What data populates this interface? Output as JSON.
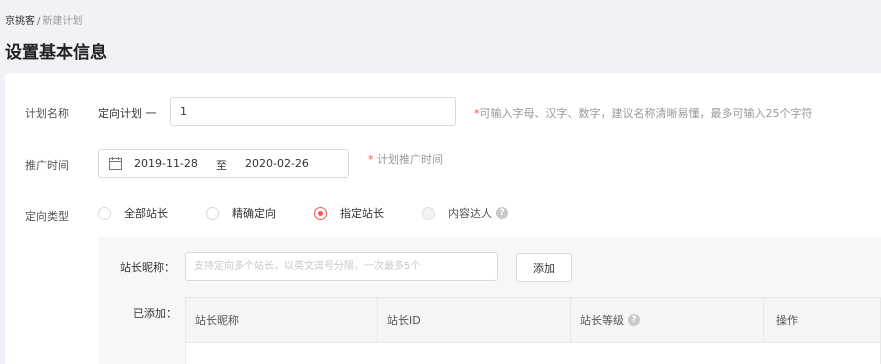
{
  "breadcrumb": {
    "root": "京挑客",
    "separator": "/",
    "current": "新建计划"
  },
  "page_title": "设置基本信息",
  "form": {
    "plan_name": {
      "label": "计划名称",
      "prefix": "定向计划 一",
      "value": "1",
      "hint_mark": "*",
      "hint": "可输入字母、汉字、数字，建议名称清晰易懂，最多可输入25个字符"
    },
    "promo_time": {
      "label": "推广时间",
      "start_date": "2019-11-28",
      "to": "至",
      "end_date": "2020-02-26",
      "hint_mark": "*",
      "hint": " 计划推广时间"
    },
    "target_type": {
      "label": "定向类型",
      "options": [
        {
          "label": "全部站长",
          "state": "unchecked"
        },
        {
          "label": "精确定向",
          "state": "unchecked"
        },
        {
          "label": "指定站长",
          "state": "checked"
        },
        {
          "label": "内容达人",
          "state": "disabled"
        }
      ],
      "info_icon": "?"
    },
    "specified": {
      "nickname_label": "站长昵称：",
      "nickname_placeholder": "支持定向多个站长，以英文逗号分隔，一次最多5个",
      "add_button": "添加",
      "added_label": "已添加：",
      "table_headers": [
        "站长昵称",
        "站长ID",
        "站长等级",
        "操作"
      ],
      "info_icon": "?"
    }
  },
  "colors": {
    "accent": "#f5564f",
    "page_bg": "#f0f2f8",
    "panel_bg": "#f7f7f7"
  },
  "icons": {
    "calendar": "calendar-icon",
    "info": "info-icon"
  }
}
